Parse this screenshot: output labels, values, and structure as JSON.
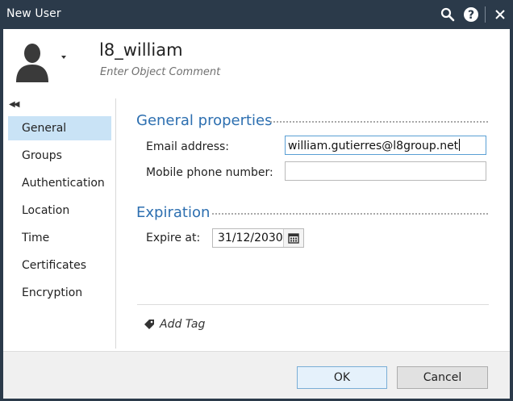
{
  "window": {
    "title": "New User",
    "icons": [
      "search-icon",
      "help-icon",
      "close-icon"
    ]
  },
  "header": {
    "object_name": "l8_william",
    "comment_placeholder": "Enter Object Comment",
    "avatar_icon": "user-silhouette-icon"
  },
  "sidebar": {
    "collapse_icon": "double-chevron-left-icon",
    "items": [
      {
        "label": "General",
        "active": true
      },
      {
        "label": "Groups"
      },
      {
        "label": "Authentication"
      },
      {
        "label": "Location"
      },
      {
        "label": "Time"
      },
      {
        "label": "Certificates"
      },
      {
        "label": "Encryption"
      }
    ]
  },
  "general": {
    "title": "General properties",
    "email_label": "Email address:",
    "email_value": "william.gutierres@l8group.net",
    "mobile_label": "Mobile phone number:",
    "mobile_value": ""
  },
  "expiration": {
    "title": "Expiration",
    "expire_label": "Expire at:",
    "expire_value": "31/12/2030",
    "calendar_icon": "calendar-icon"
  },
  "tags": {
    "add_label": "Add Tag",
    "tag_icon": "tag-icon"
  },
  "footer": {
    "ok_label": "OK",
    "cancel_label": "Cancel"
  },
  "colors": {
    "titlebar": "#2b3a4a",
    "accent_text": "#2d6fb0",
    "selected_nav": "#c9e3f6",
    "ok_border": "#7aaed6"
  }
}
